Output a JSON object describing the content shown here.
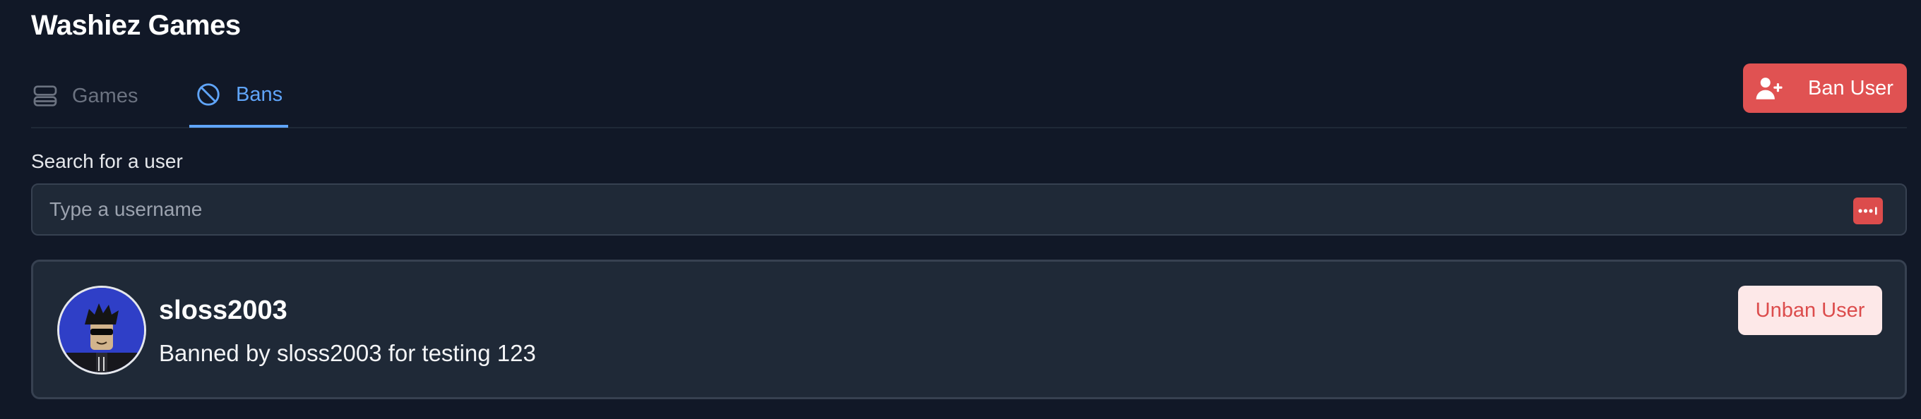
{
  "app": {
    "title": "Washiez Games"
  },
  "tabs": [
    {
      "label": "Games",
      "icon": "server-icon",
      "active": false
    },
    {
      "label": "Bans",
      "icon": "ban-icon",
      "active": true
    }
  ],
  "toolbar": {
    "ban_user_label": "Ban User",
    "ban_user_icon": "user-plus-icon"
  },
  "search": {
    "label": "Search for a user",
    "placeholder": "Type a username",
    "value": "",
    "trailing_icon": "password-manager-icon"
  },
  "bans": [
    {
      "username": "sloss2003",
      "reason": "Banned by sloss2003 for testing 123",
      "action_label": "Unban User",
      "avatar_icon": "avatar"
    }
  ],
  "colors": {
    "background": "#111827",
    "surface": "#1f2937",
    "border": "#374151",
    "accent": "#60a5fa",
    "danger": "#e05252",
    "danger_soft": "#fde8e8",
    "muted": "#6b7280"
  }
}
